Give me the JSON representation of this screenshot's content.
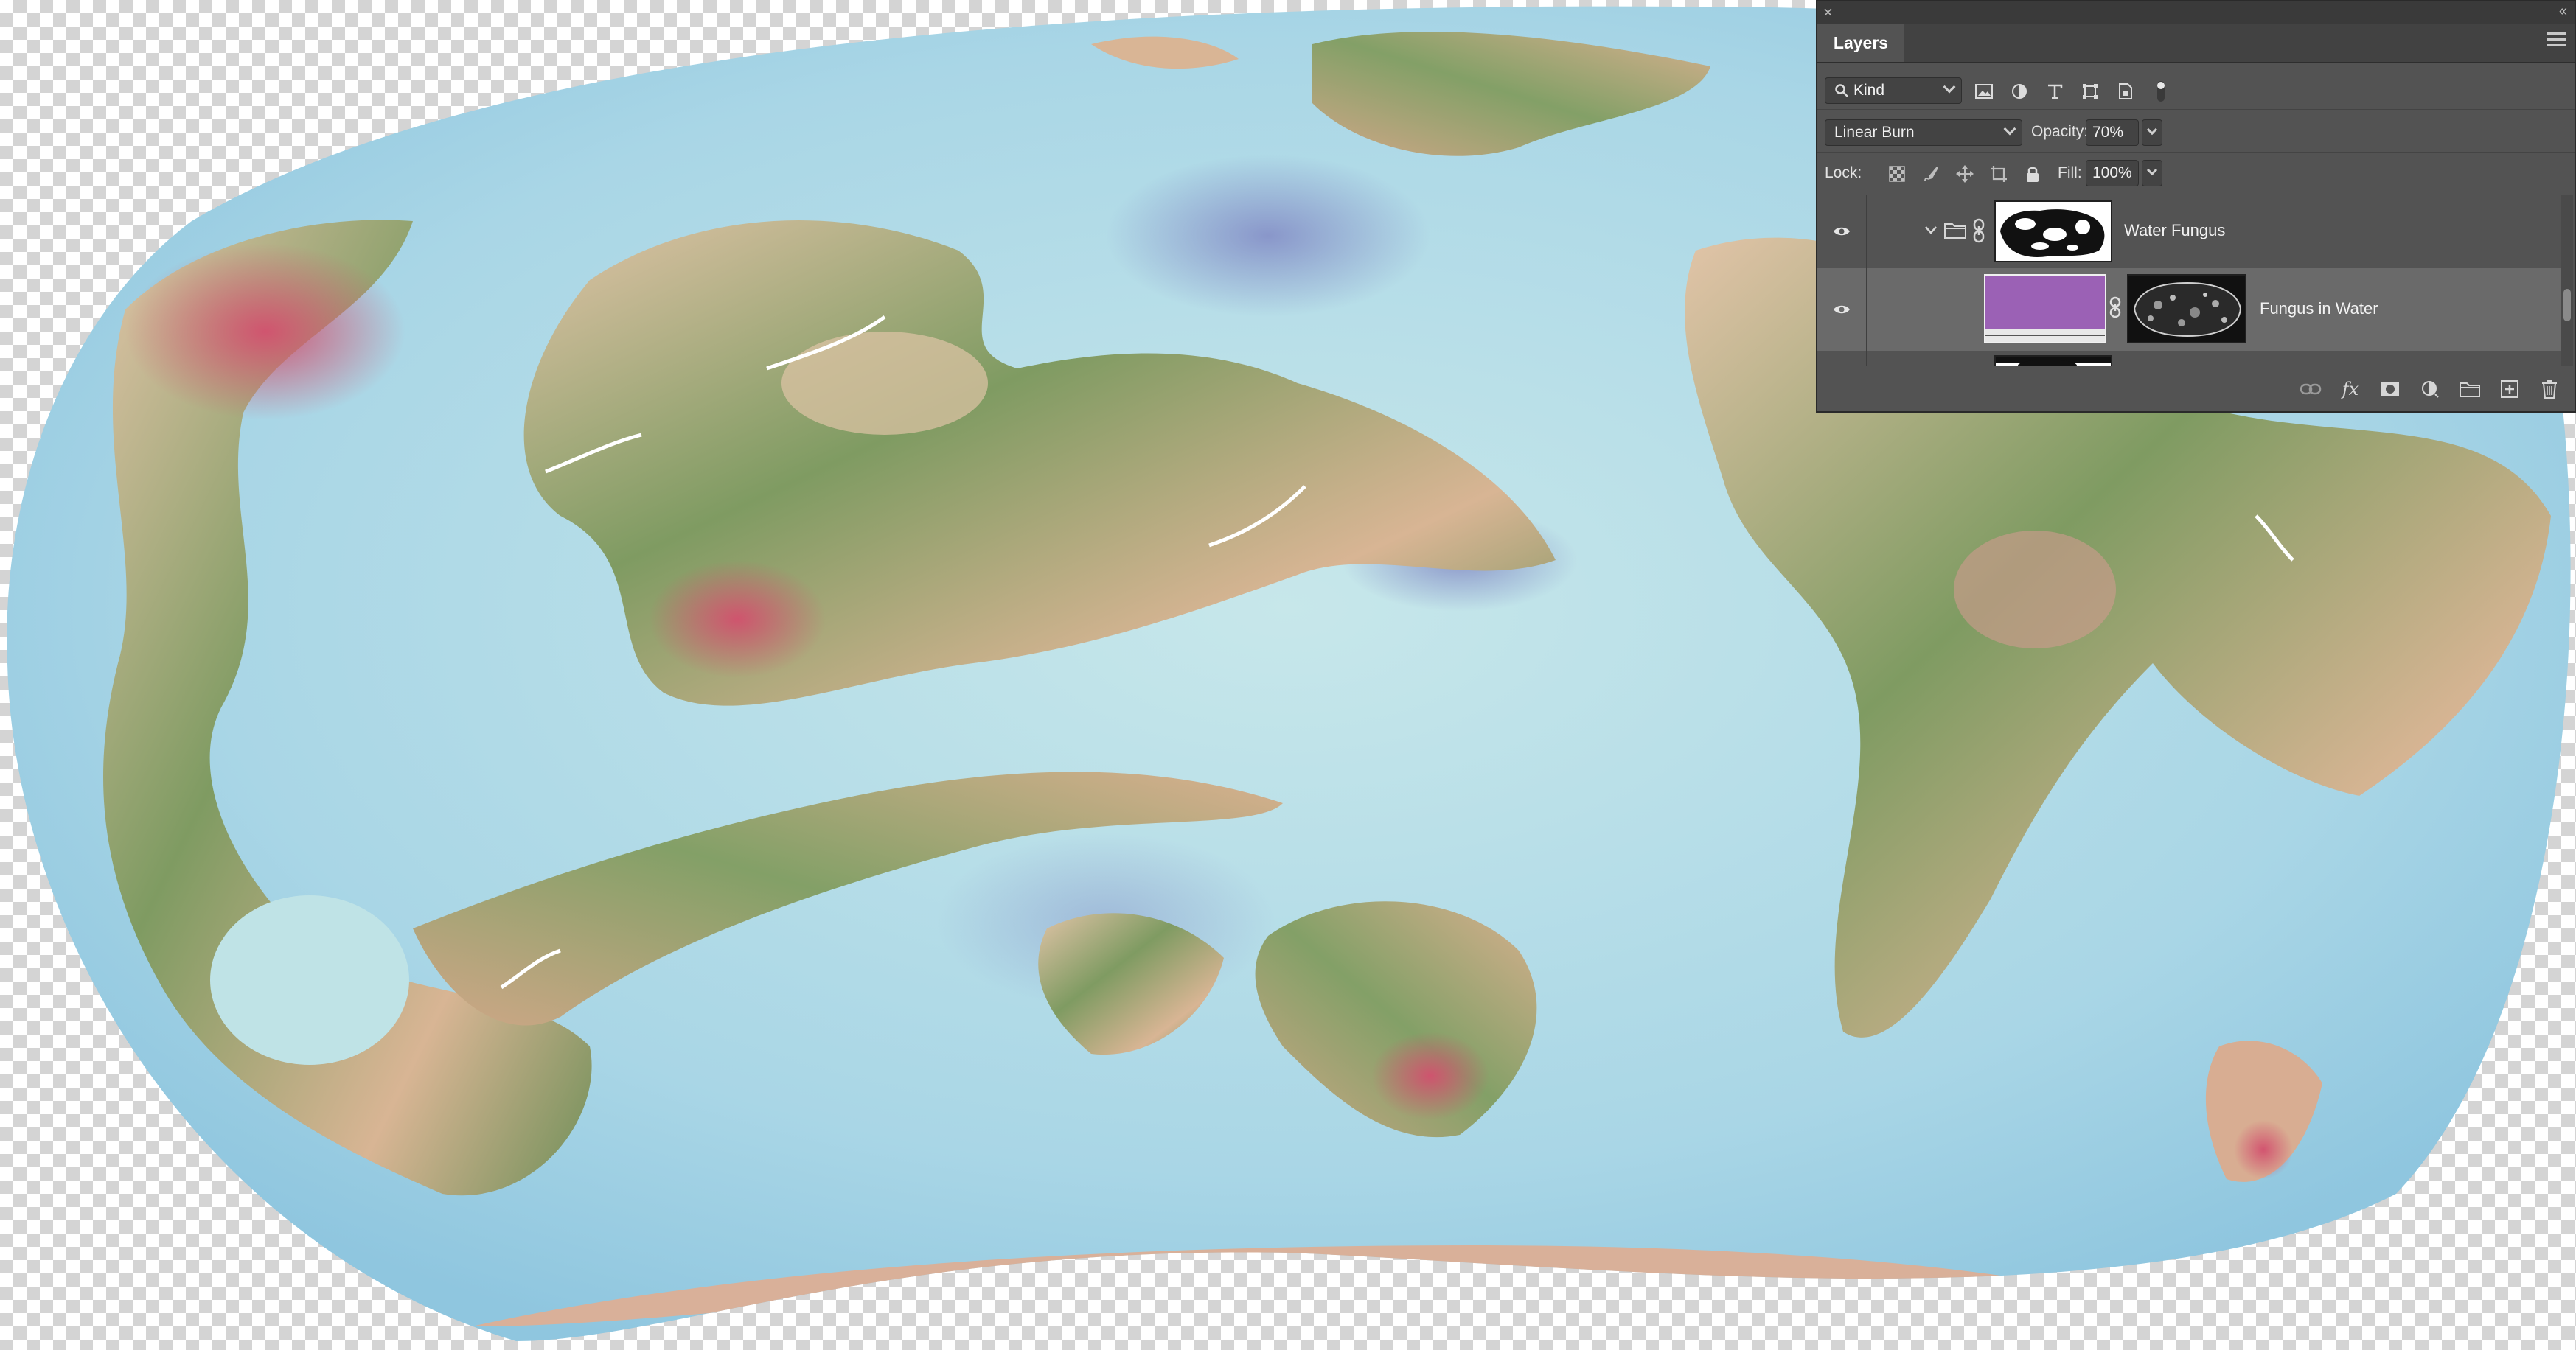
{
  "panel": {
    "title": "Layers",
    "filter_kind": "Kind",
    "blend_mode": "Linear Burn",
    "opacity_label": "Opacity:",
    "opacity_value": "70%",
    "lock_label": "Lock:",
    "fill_label": "Fill:",
    "fill_value": "100%"
  },
  "layers": [
    {
      "name": "Water Fungus",
      "type": "group",
      "visible": true,
      "expanded": true
    },
    {
      "name": "Fungus in Water",
      "type": "solid-fill",
      "visible": true,
      "selected": true,
      "fill_color": "#9b61b5"
    }
  ],
  "icons": {
    "filter": [
      "image-filter-icon",
      "adjustment-filter-icon",
      "type-filter-icon",
      "shape-filter-icon",
      "smart-object-filter-icon",
      "filter-toggle-icon"
    ],
    "lock": [
      "lock-transparent-icon",
      "lock-image-icon",
      "lock-position-icon",
      "lock-artboard-icon",
      "lock-all-icon"
    ],
    "footer": [
      "link-layers-icon",
      "fx-icon",
      "add-mask-icon",
      "adjustment-layer-icon",
      "new-group-icon",
      "new-layer-icon",
      "delete-layer-icon"
    ]
  },
  "colors": {
    "panel_bg": "#535353",
    "selected_row": "#6a6a6a",
    "ocean": "#a9d7e4",
    "land_green": "#7d9a62",
    "land_tan": "#d9b999",
    "land_red": "#c6506b"
  }
}
